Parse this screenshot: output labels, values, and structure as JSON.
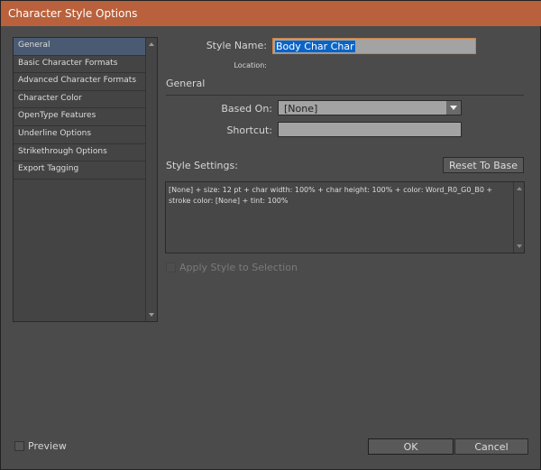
{
  "window": {
    "title": "Character Style Options"
  },
  "sidebar": {
    "items": [
      {
        "label": "General",
        "selected": true
      },
      {
        "label": "Basic Character Formats"
      },
      {
        "label": "Advanced Character Formats"
      },
      {
        "label": "Character Color"
      },
      {
        "label": "OpenType Features"
      },
      {
        "label": "Underline Options"
      },
      {
        "label": "Strikethrough Options"
      },
      {
        "label": "Export Tagging"
      }
    ]
  },
  "form": {
    "style_name_label": "Style Name:",
    "style_name_value": "Body Char Char",
    "location_label": "Location:",
    "section_title": "General",
    "based_on_label": "Based On:",
    "based_on_value": "[None]",
    "shortcut_label": "Shortcut:",
    "shortcut_value": "",
    "style_settings_label": "Style Settings:",
    "reset_label": "Reset To Base",
    "style_settings_text": "[None] + size: 12 pt + char width: 100% + char height: 100% + color: Word_R0_G0_B0 + stroke color: [None] + tint: 100%",
    "apply_label": "Apply Style to Selection"
  },
  "footer": {
    "preview_label": "Preview",
    "ok_label": "OK",
    "cancel_label": "Cancel"
  },
  "colors": {
    "titlebar": "#b9603c",
    "selection": "#0a64c8",
    "focus": "#d08040"
  }
}
